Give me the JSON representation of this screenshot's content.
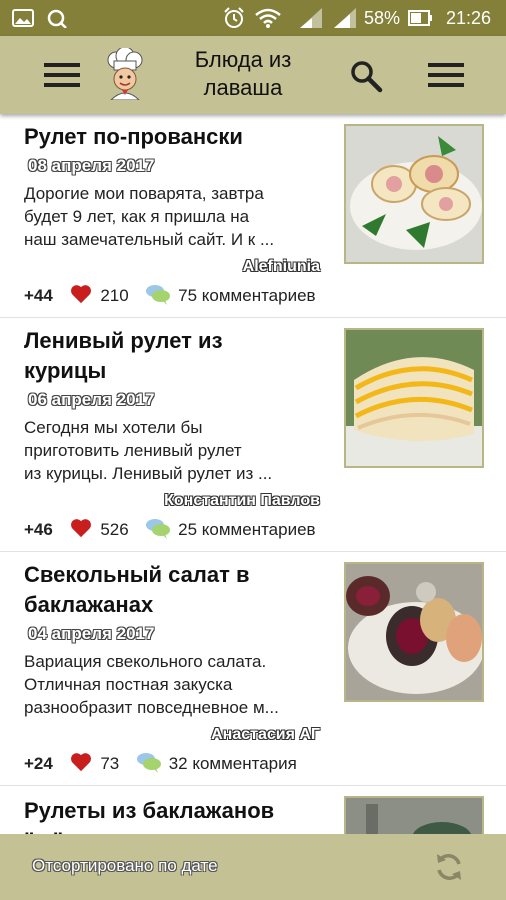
{
  "status_bar": {
    "battery_percent": "58%",
    "time": "21:26",
    "icons": [
      "gallery-icon",
      "sync-icon",
      "alarm-icon",
      "wifi-icon",
      "signal-icon",
      "signal-r-icon",
      "battery-icon"
    ]
  },
  "app_bar": {
    "title_line1": "Блюда из",
    "title_line2": "лаваша",
    "icons": [
      "menu-icon",
      "chef-logo-icon",
      "search-icon",
      "overflow-menu-icon"
    ]
  },
  "recipes": [
    {
      "title_line1": "Рулет по-провански",
      "date": "08 апреля 2017",
      "desc_line1": "Дорогие мои поварята, завтра",
      "desc_line2": "будет 9 лет, как я пришла на",
      "desc_line3": "наш замечательный сайт. И к ...",
      "author": "Alefniunia",
      "rating": "+44",
      "likes": "210",
      "comments": "75 комментариев"
    },
    {
      "title_line1": "Ленивый рулет из",
      "title_line2": "курицы",
      "date": "06 апреля 2017",
      "desc_line1": "Сегодня мы хотели бы",
      "desc_line2": "приготовить ленивый рулет",
      "desc_line3": "из курицы. Ленивый рулет из ...",
      "author": "Константин Павлов",
      "rating": "+46",
      "likes": "526",
      "comments": "25 комментариев"
    },
    {
      "title_line1": "Свекольный салат в",
      "title_line2": "баклажанах",
      "date": "04 апреля 2017",
      "desc_line1": "Вариация свекольного салата.",
      "desc_line2": "Отличная постная закуска",
      "desc_line3": "разнообразит повседневное м...",
      "author": "Анастасия АГ",
      "rating": "+24",
      "likes": "73",
      "comments": "32 комментария"
    },
    {
      "title_line1": "Рулеты из баклажанов",
      "title_line2": "\"...\""
    }
  ],
  "bottom_bar": {
    "sort_label": "Отсортировано по дате",
    "icons": [
      "refresh-icon"
    ]
  }
}
